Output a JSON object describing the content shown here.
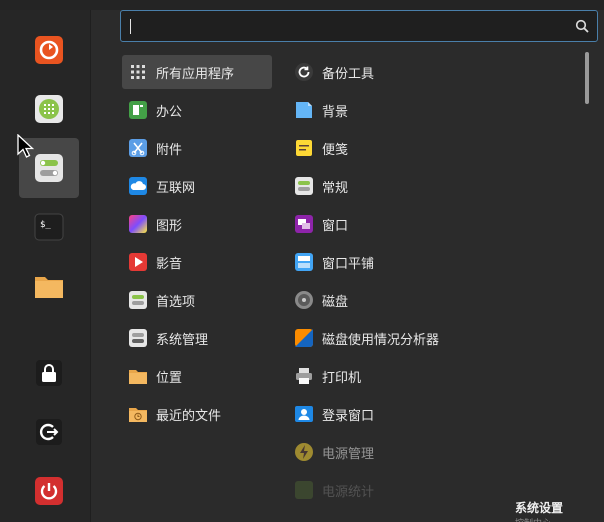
{
  "search": {
    "value": "",
    "icon": "search-icon"
  },
  "favorites": [
    {
      "name": "firefox",
      "icon": "firefox-icon",
      "color": "#e95420"
    },
    {
      "name": "calculator",
      "icon": "calculator-icon",
      "color": "#8bc34a"
    },
    {
      "name": "system-settings",
      "icon": "toggle-switch-icon",
      "color": "#e0e0e0",
      "active": true
    },
    {
      "name": "terminal",
      "icon": "terminal-icon",
      "color": "#2e2e2e"
    },
    {
      "name": "files",
      "icon": "folder-icon",
      "color": "#f4b860"
    },
    {
      "name": "lock-screen",
      "icon": "lock-icon",
      "color": "#ffffff"
    },
    {
      "name": "logout",
      "icon": "logout-icon",
      "color": "#ffffff"
    },
    {
      "name": "shutdown",
      "icon": "power-icon",
      "color": "#d32f2f"
    }
  ],
  "categories": [
    {
      "label": "所有应用程序",
      "icon": "grid-icon",
      "selected": true
    },
    {
      "label": "办公",
      "icon": "office-icon"
    },
    {
      "label": "附件",
      "icon": "accessories-icon"
    },
    {
      "label": "互联网",
      "icon": "internet-icon"
    },
    {
      "label": "图形",
      "icon": "graphics-icon"
    },
    {
      "label": "影音",
      "icon": "multimedia-icon"
    },
    {
      "label": "首选项",
      "icon": "preferences-icon"
    },
    {
      "label": "系统管理",
      "icon": "administration-icon"
    },
    {
      "label": "位置",
      "icon": "places-folder-icon"
    },
    {
      "label": "最近的文件",
      "icon": "recent-files-icon"
    }
  ],
  "apps": [
    {
      "label": "备份工具",
      "icon": "backup-icon"
    },
    {
      "label": "背景",
      "icon": "background-icon"
    },
    {
      "label": "便笺",
      "icon": "sticky-notes-icon"
    },
    {
      "label": "常规",
      "icon": "general-settings-icon"
    },
    {
      "label": "窗口",
      "icon": "windows-icon"
    },
    {
      "label": "窗口平铺",
      "icon": "window-tiling-icon"
    },
    {
      "label": "磁盘",
      "icon": "disks-icon"
    },
    {
      "label": "磁盘使用情况分析器",
      "icon": "disk-usage-icon"
    },
    {
      "label": "打印机",
      "icon": "printer-icon"
    },
    {
      "label": "登录窗口",
      "icon": "login-window-icon"
    },
    {
      "label": "电源管理",
      "icon": "power-management-icon"
    },
    {
      "label": "电源统计",
      "icon": "power-statistics-icon"
    }
  ],
  "description": {
    "title": "系统设置",
    "subtitle": "控制中心"
  },
  "colors": {
    "accent": "#4a7faa",
    "panel": "#2b2b2b",
    "sidebar": "#262626",
    "selected": "#474747"
  }
}
